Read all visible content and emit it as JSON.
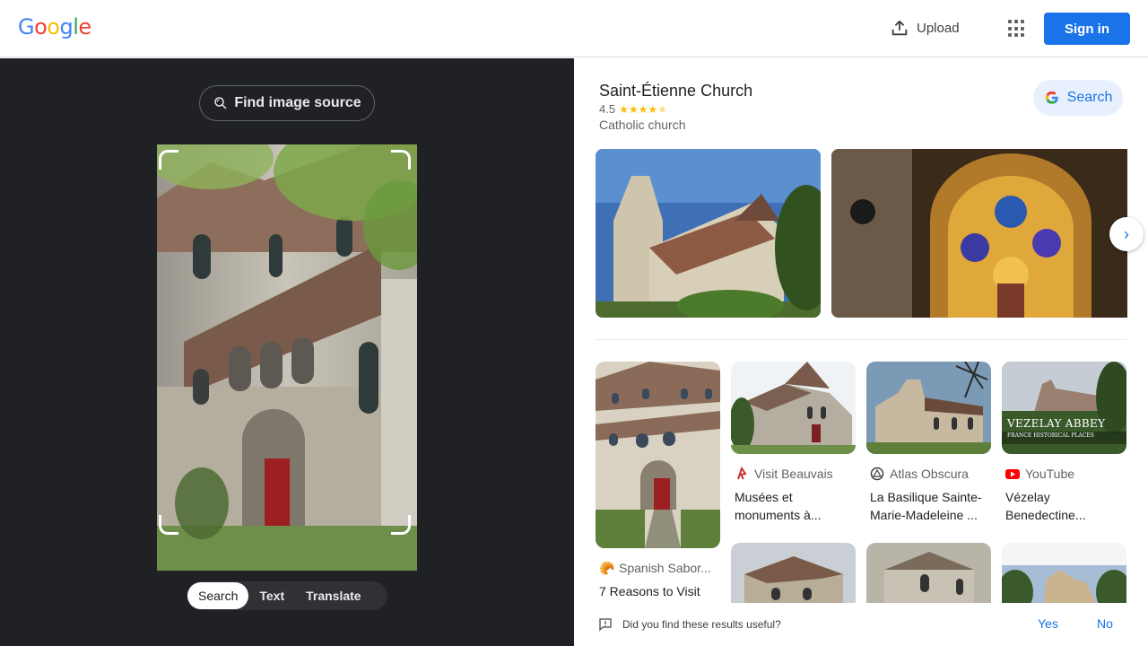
{
  "header": {
    "logo_letters": [
      {
        "char": "G",
        "color": "#4285f4"
      },
      {
        "char": "o",
        "color": "#ea4335"
      },
      {
        "char": "o",
        "color": "#fbbc05"
      },
      {
        "char": "g",
        "color": "#4285f4"
      },
      {
        "char": "l",
        "color": "#34a853"
      },
      {
        "char": "e",
        "color": "#ea4335"
      }
    ],
    "upload_label": "Upload",
    "apps_icon": "apps-grid-icon",
    "signin_label": "Sign in"
  },
  "lens_panel": {
    "find_source_label": "Find image source",
    "modes": [
      "Search",
      "Text",
      "Translate"
    ],
    "active_mode": "Search"
  },
  "knowledge_panel": {
    "title": "Saint-Étienne Church",
    "rating": "4.5",
    "stars": 4.5,
    "category": "Catholic church",
    "search_label": "Search"
  },
  "results": [
    {
      "source": "Spanish Sabor...",
      "title": "7 Reasons to Visit",
      "icon": "croissant-icon"
    },
    {
      "source": "Visit Beauvais",
      "title": "Musées et monuments à...",
      "icon": "visit-beauvais-logo-icon"
    },
    {
      "source": "Atlas Obscura",
      "title": "La Basilique Sainte-Marie-Madeleine ...",
      "icon": "atlas-obscura-logo-icon"
    },
    {
      "source": "YouTube",
      "title": "Vézelay Benedectine...",
      "icon": "youtube-logo-icon",
      "thumb_text": "VEZELAY ABBEY",
      "thumb_subtext": "FRANCE HISTORICAL PLACES"
    }
  ],
  "feedback": {
    "question": "Did you find these results useful?",
    "yes_label": "Yes",
    "no_label": "No"
  }
}
